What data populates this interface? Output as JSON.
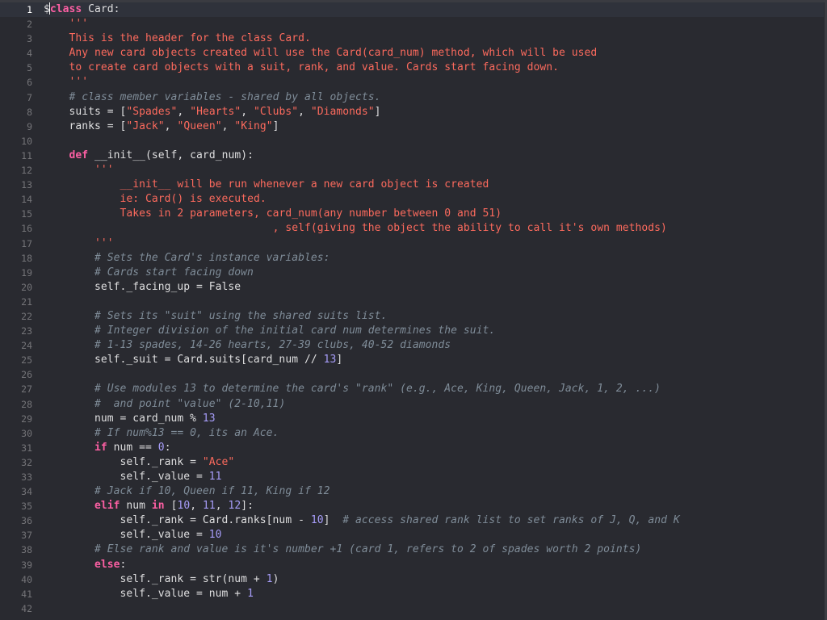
{
  "editor": {
    "current_line": 1,
    "language": "python",
    "colors": {
      "background": "#292a30",
      "current_line": "#2f323b",
      "keyword": "#fc5fa3",
      "string": "#fc6a5d",
      "comment": "#7f8c98",
      "number": "#a79df9",
      "plain": "#dfdfe0",
      "line_number": "#747478"
    },
    "lines": [
      {
        "n": "1",
        "tokens": [
          [
            "p",
            "$"
          ],
          [
            "caret",
            ""
          ],
          [
            "kw",
            "class"
          ],
          [
            "p",
            " Card:"
          ]
        ]
      },
      {
        "n": "2",
        "tokens": [
          [
            "p",
            "    "
          ],
          [
            "doc",
            "'''"
          ]
        ]
      },
      {
        "n": "3",
        "tokens": [
          [
            "p",
            "    "
          ],
          [
            "doc",
            "This is the header for the class Card."
          ]
        ]
      },
      {
        "n": "4",
        "tokens": [
          [
            "p",
            "    "
          ],
          [
            "doc",
            "Any new card objects created will use the Card(card_num) method, which will be used"
          ]
        ]
      },
      {
        "n": "5",
        "tokens": [
          [
            "p",
            "    "
          ],
          [
            "doc",
            "to create card objects with a suit, rank, and value. Cards start facing down."
          ]
        ]
      },
      {
        "n": "6",
        "tokens": [
          [
            "p",
            "    "
          ],
          [
            "doc",
            "'''"
          ]
        ]
      },
      {
        "n": "7",
        "tokens": [
          [
            "p",
            "    "
          ],
          [
            "cm",
            "# class member variables - shared by all objects."
          ]
        ]
      },
      {
        "n": "8",
        "tokens": [
          [
            "p",
            "    suits = ["
          ],
          [
            "str",
            "\"Spades\""
          ],
          [
            "p",
            ", "
          ],
          [
            "str",
            "\"Hearts\""
          ],
          [
            "p",
            ", "
          ],
          [
            "str",
            "\"Clubs\""
          ],
          [
            "p",
            ", "
          ],
          [
            "str",
            "\"Diamonds\""
          ],
          [
            "p",
            "]"
          ]
        ]
      },
      {
        "n": "9",
        "tokens": [
          [
            "p",
            "    ranks = ["
          ],
          [
            "str",
            "\"Jack\""
          ],
          [
            "p",
            ", "
          ],
          [
            "str",
            "\"Queen\""
          ],
          [
            "p",
            ", "
          ],
          [
            "str",
            "\"King\""
          ],
          [
            "p",
            "]"
          ]
        ]
      },
      {
        "n": "10",
        "tokens": []
      },
      {
        "n": "11",
        "tokens": [
          [
            "p",
            "    "
          ],
          [
            "kw",
            "def"
          ],
          [
            "p",
            " __init__(self, card_num):"
          ]
        ]
      },
      {
        "n": "12",
        "tokens": [
          [
            "p",
            "        "
          ],
          [
            "doc",
            "'''"
          ]
        ]
      },
      {
        "n": "13",
        "tokens": [
          [
            "p",
            "            "
          ],
          [
            "doc",
            "__init__ will be run whenever a new card object is created"
          ]
        ]
      },
      {
        "n": "14",
        "tokens": [
          [
            "p",
            "            "
          ],
          [
            "doc",
            "ie: Card() is executed."
          ]
        ]
      },
      {
        "n": "15",
        "tokens": [
          [
            "p",
            "            "
          ],
          [
            "doc",
            "Takes in 2 parameters, card_num(any number between 0 and 51)"
          ]
        ]
      },
      {
        "n": "16",
        "tokens": [
          [
            "p",
            "                                    "
          ],
          [
            "doc",
            ", self(giving the object the ability to call it's own methods)"
          ]
        ]
      },
      {
        "n": "17",
        "tokens": [
          [
            "p",
            "        "
          ],
          [
            "doc",
            "'''"
          ]
        ]
      },
      {
        "n": "18",
        "tokens": [
          [
            "p",
            "        "
          ],
          [
            "cm",
            "# Sets the Card's instance variables:"
          ]
        ]
      },
      {
        "n": "19",
        "tokens": [
          [
            "p",
            "        "
          ],
          [
            "cm",
            "# Cards start facing down"
          ]
        ]
      },
      {
        "n": "20",
        "tokens": [
          [
            "p",
            "        self._facing_up = False"
          ]
        ]
      },
      {
        "n": "21",
        "tokens": []
      },
      {
        "n": "22",
        "tokens": [
          [
            "p",
            "        "
          ],
          [
            "cm",
            "# Sets its \"suit\" using the shared suits list."
          ]
        ]
      },
      {
        "n": "23",
        "tokens": [
          [
            "p",
            "        "
          ],
          [
            "cm",
            "# Integer division of the initial card num determines the suit."
          ]
        ]
      },
      {
        "n": "24",
        "tokens": [
          [
            "p",
            "        "
          ],
          [
            "cm",
            "# 1-13 spades, 14-26 hearts, 27-39 clubs, 40-52 diamonds"
          ]
        ]
      },
      {
        "n": "25",
        "tokens": [
          [
            "p",
            "        self._suit = Card.suits[card_num // "
          ],
          [
            "num",
            "13"
          ],
          [
            "p",
            "]"
          ]
        ]
      },
      {
        "n": "26",
        "tokens": []
      },
      {
        "n": "27",
        "tokens": [
          [
            "p",
            "        "
          ],
          [
            "cm",
            "# Use modules 13 to determine the card's \"rank\" (e.g., Ace, King, Queen, Jack, 1, 2, ...)"
          ]
        ]
      },
      {
        "n": "28",
        "tokens": [
          [
            "p",
            "        "
          ],
          [
            "cm",
            "#  and point \"value\" (2-10,11)"
          ]
        ]
      },
      {
        "n": "29",
        "tokens": [
          [
            "p",
            "        num = card_num % "
          ],
          [
            "num",
            "13"
          ]
        ]
      },
      {
        "n": "30",
        "tokens": [
          [
            "p",
            "        "
          ],
          [
            "cm",
            "# If num%13 == 0, its an Ace."
          ]
        ]
      },
      {
        "n": "31",
        "tokens": [
          [
            "p",
            "        "
          ],
          [
            "kw",
            "if"
          ],
          [
            "p",
            " num == "
          ],
          [
            "num",
            "0"
          ],
          [
            "p",
            ":"
          ]
        ]
      },
      {
        "n": "32",
        "tokens": [
          [
            "p",
            "            self._rank = "
          ],
          [
            "str",
            "\"Ace\""
          ]
        ]
      },
      {
        "n": "33",
        "tokens": [
          [
            "p",
            "            self._value = "
          ],
          [
            "num",
            "11"
          ]
        ]
      },
      {
        "n": "34",
        "tokens": [
          [
            "p",
            "        "
          ],
          [
            "cm",
            "# Jack if 10, Queen if 11, King if 12"
          ]
        ]
      },
      {
        "n": "35",
        "tokens": [
          [
            "p",
            "        "
          ],
          [
            "kw",
            "elif"
          ],
          [
            "p",
            " num "
          ],
          [
            "kw",
            "in"
          ],
          [
            "p",
            " ["
          ],
          [
            "num",
            "10"
          ],
          [
            "p",
            ", "
          ],
          [
            "num",
            "11"
          ],
          [
            "p",
            ", "
          ],
          [
            "num",
            "12"
          ],
          [
            "p",
            "]:"
          ]
        ]
      },
      {
        "n": "36",
        "tokens": [
          [
            "p",
            "            self._rank = Card.ranks[num - "
          ],
          [
            "num",
            "10"
          ],
          [
            "p",
            "]  "
          ],
          [
            "cm",
            "# access shared rank list to set ranks of J, Q, and K"
          ]
        ]
      },
      {
        "n": "37",
        "tokens": [
          [
            "p",
            "            self._value = "
          ],
          [
            "num",
            "10"
          ]
        ]
      },
      {
        "n": "38",
        "tokens": [
          [
            "p",
            "        "
          ],
          [
            "cm",
            "# Else rank and value is it's number +1 (card 1, refers to 2 of spades worth 2 points)"
          ]
        ]
      },
      {
        "n": "39",
        "tokens": [
          [
            "p",
            "        "
          ],
          [
            "kw",
            "else"
          ],
          [
            "p",
            ":"
          ]
        ]
      },
      {
        "n": "40",
        "tokens": [
          [
            "p",
            "            self._rank = str(num + "
          ],
          [
            "num",
            "1"
          ],
          [
            "p",
            ")"
          ]
        ]
      },
      {
        "n": "41",
        "tokens": [
          [
            "p",
            "            self._value = num + "
          ],
          [
            "num",
            "1"
          ]
        ]
      },
      {
        "n": "42",
        "tokens": []
      }
    ]
  }
}
